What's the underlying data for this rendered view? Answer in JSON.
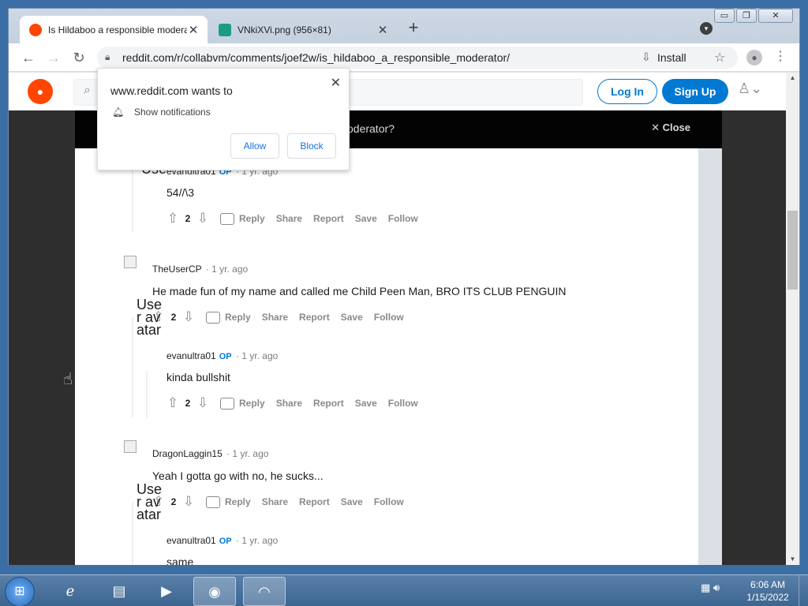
{
  "browser": {
    "tabs": [
      {
        "title": "Is Hildaboo a responsible modera",
        "close": "✕"
      },
      {
        "title": "VNkiXVi.png (956×81)",
        "close": "✕"
      }
    ],
    "new_tab": "+",
    "url": "reddit.com/r/collabvm/comments/joef2w/is_hildaboo_a_responsible_moderator/",
    "install_label": "Install"
  },
  "reddit": {
    "login_label": "Log In",
    "signup_label": "Sign Up",
    "post_title_partial": "oderator?",
    "close_label": "Close"
  },
  "notification": {
    "title": "www.reddit.com wants to",
    "line": "Show notifications",
    "allow_label": "Allow",
    "block_label": "Block"
  },
  "comments": [
    {
      "user": "evanultra01",
      "op": "OP",
      "age": "· 1 yr. ago",
      "body": "54//\\3",
      "score": "2"
    },
    {
      "user": "TheUserCP",
      "op": "",
      "age": "· 1 yr. ago",
      "body": "He made fun of my name and called me Child Peen Man, BRO ITS CLUB PENGUIN",
      "score": "2"
    },
    {
      "user": "evanultra01",
      "op": "OP",
      "age": "· 1 yr. ago",
      "body": "kinda bullshit",
      "score": "2"
    },
    {
      "user": "DragonLaggin15",
      "op": "",
      "age": "· 1 yr. ago",
      "body": "Yeah I gotta go with no, he sucks...",
      "score": "2"
    },
    {
      "user": "evanultra01",
      "op": "OP",
      "age": "· 1 yr. ago",
      "body": "same",
      "score": ""
    }
  ],
  "actions": {
    "reply": "Reply",
    "share": "Share",
    "report": "Report",
    "save": "Save",
    "follow": "Follow"
  },
  "broken_avatar_text": "User avatar",
  "taskbar": {
    "time": "6:06 AM",
    "date": "1/15/2022"
  },
  "icons": [
    "reddit-favicon",
    "image-favicon",
    "back-icon",
    "forward-icon",
    "reload-icon",
    "lock-icon",
    "install-icon",
    "star-icon",
    "profile-icon",
    "menu-icon",
    "search-icon",
    "bell-icon",
    "upvote-icon",
    "downvote-icon",
    "comment-icon",
    "close-icon"
  ],
  "colors": {
    "reddit_orange": "#ff4500",
    "reddit_blue": "#0079d3",
    "op_blue": "#0079d3"
  }
}
